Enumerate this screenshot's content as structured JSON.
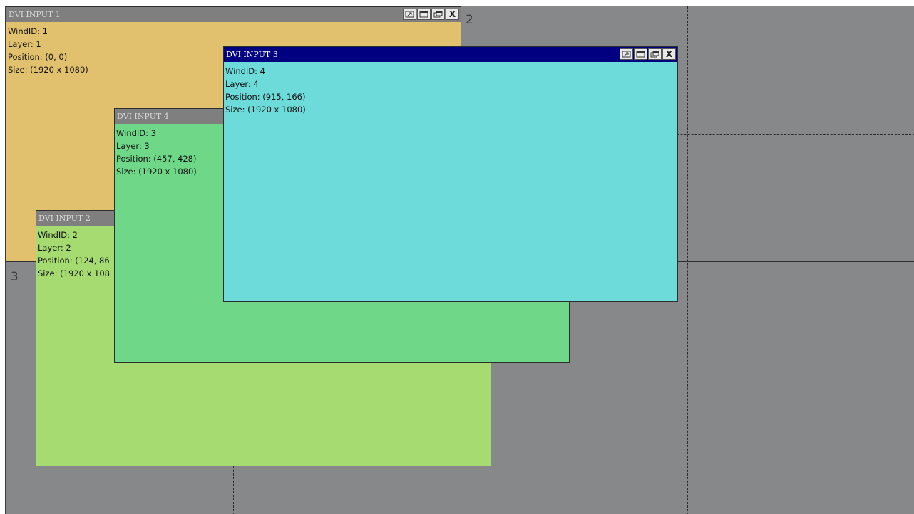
{
  "screens": [
    {
      "number": "2"
    },
    {
      "number": "3"
    }
  ],
  "windows": [
    {
      "title": "DVI INPUT 1",
      "color": "#E2C16E",
      "active": false,
      "lines": [
        "WindID: 1",
        "Layer: 1",
        "Position: (0, 0)",
        "Size: (1920 x 1080)"
      ]
    },
    {
      "title": "DVI INPUT 2",
      "color": "#A6DB72",
      "active": false,
      "lines": [
        "WindID: 2",
        "Layer: 2",
        "Position: (124, 86",
        "Size: (1920 x 108"
      ]
    },
    {
      "title": "DVI INPUT 4",
      "color": "#6ED888",
      "active": false,
      "lines": [
        "WindID: 3",
        "Layer: 3",
        "Position: (457, 428)",
        "Size: (1920 x 1080)"
      ]
    },
    {
      "title": "DVI INPUT 3",
      "color": "#6DDBD9",
      "active": true,
      "lines": [
        "WindID: 4",
        "Layer: 4",
        "Position: (915, 166)",
        "Size: (1920 x 1080)"
      ]
    }
  ],
  "window_controls": {
    "close_label": "X",
    "icons": [
      "restore-window-icon",
      "maximize-icon",
      "cascade-icon",
      "close-icon"
    ]
  },
  "colors": {
    "wall_background": "#878889",
    "active_titlebar": "#000080",
    "inactive_titlebar": "#7F7F7F"
  }
}
